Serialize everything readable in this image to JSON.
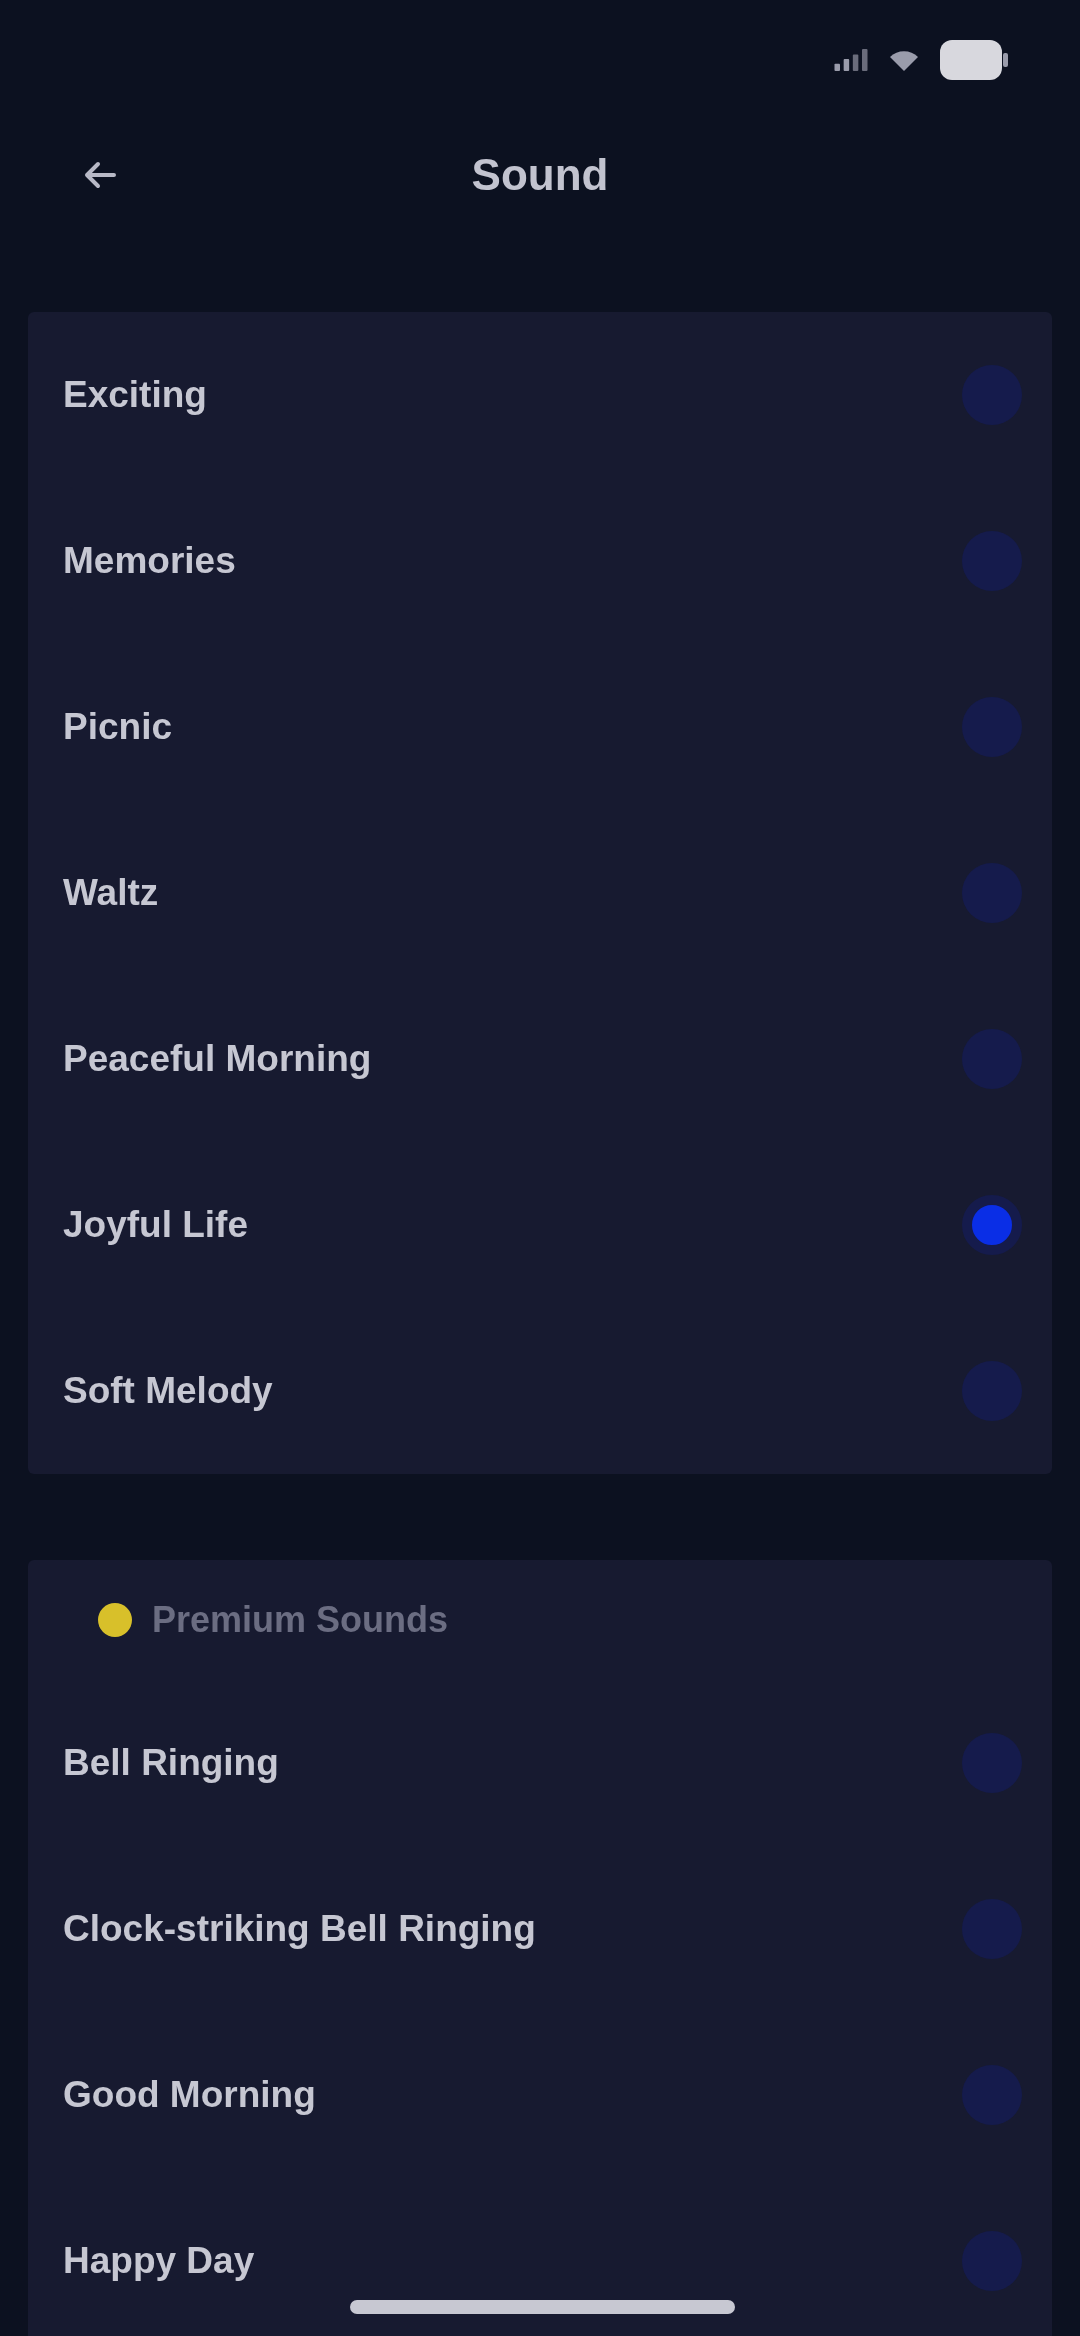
{
  "header": {
    "title": "Sound"
  },
  "sound_groups": [
    {
      "items": [
        {
          "label": "Exciting",
          "selected": false
        },
        {
          "label": "Memories",
          "selected": false
        },
        {
          "label": "Picnic",
          "selected": false
        },
        {
          "label": "Waltz",
          "selected": false
        },
        {
          "label": "Peaceful Morning",
          "selected": false
        },
        {
          "label": "Joyful Life",
          "selected": true
        },
        {
          "label": "Soft Melody",
          "selected": false
        }
      ]
    },
    {
      "heading": "Premium Sounds",
      "items": [
        {
          "label": "Bell Ringing",
          "selected": false
        },
        {
          "label": "Clock-striking Bell Ringing",
          "selected": false
        },
        {
          "label": "Good Morning",
          "selected": false
        },
        {
          "label": "Happy Day",
          "selected": false
        }
      ]
    }
  ]
}
